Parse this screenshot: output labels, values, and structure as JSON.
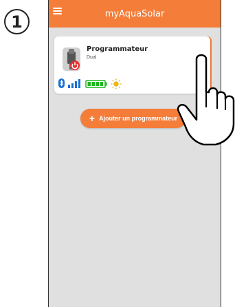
{
  "step": {
    "number": "1"
  },
  "app": {
    "title": "myAquaSolar"
  },
  "card": {
    "title": "Programmateur",
    "subtitle": "Dual",
    "icons": [
      "bluetooth-icon",
      "signal-strength-icon",
      "battery-full-icon",
      "sun-icon"
    ],
    "colors": {
      "bluetooth": "#1a6fd1",
      "battery": "#1fb71f",
      "sun": "#e0a800"
    }
  },
  "add_button": {
    "plus": "+",
    "label": "Ajouter un programmateur"
  },
  "colors": {
    "accent": "#f47d3a",
    "screen_bg": "#e0e0e0"
  }
}
